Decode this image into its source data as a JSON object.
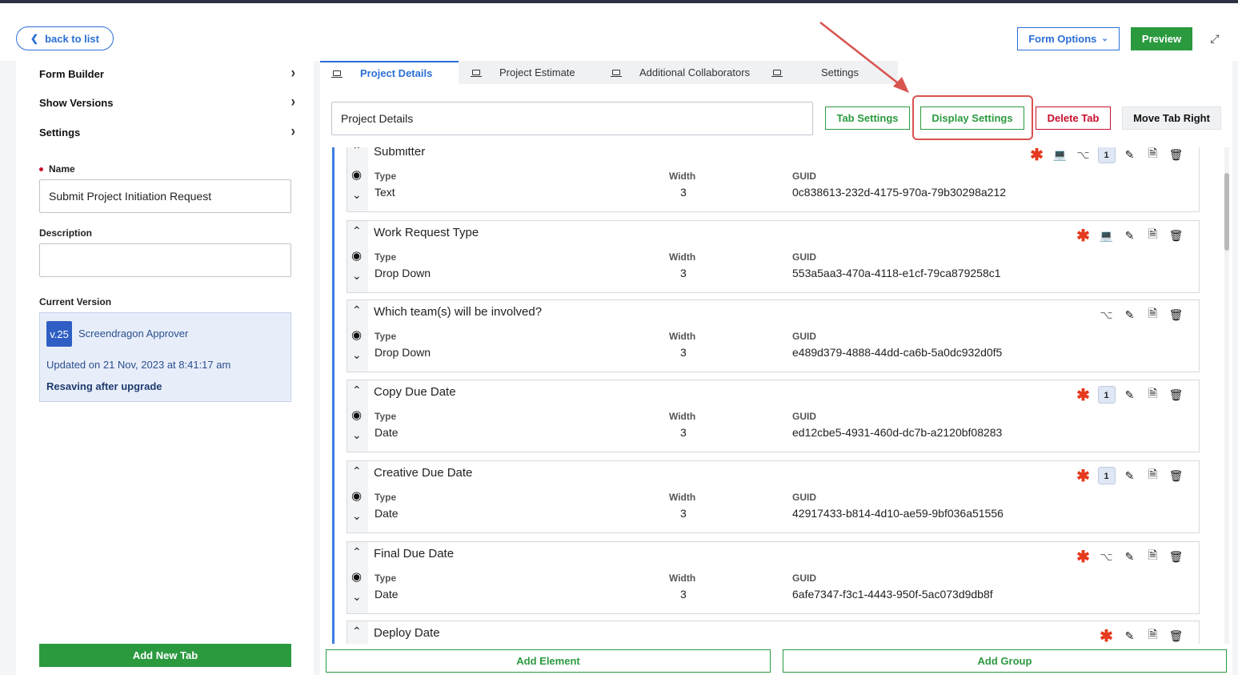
{
  "header": {
    "back_label": "back to list",
    "form_options_label": "Form Options",
    "preview_label": "Preview"
  },
  "sidebar": {
    "menu": [
      {
        "label": "Form Builder"
      },
      {
        "label": "Show Versions"
      },
      {
        "label": "Settings"
      }
    ],
    "name_label": "Name",
    "name_value": "Submit Project Initiation Request",
    "description_label": "Description",
    "description_value": "",
    "current_version_label": "Current Version",
    "version": {
      "badge": "v.25",
      "approver": "Screendragon Approver",
      "updated": "Updated on 21 Nov, 2023 at 8:41:17 am",
      "note": "Resaving after upgrade"
    },
    "add_tab_label": "Add New Tab"
  },
  "tabs": [
    {
      "label": "Project Details",
      "active": true
    },
    {
      "label": "Project Estimate",
      "active": false
    },
    {
      "label": "Additional Collaborators",
      "active": false
    },
    {
      "label": "Settings",
      "active": false
    }
  ],
  "tab_toolbar": {
    "tab_name_value": "Project Details",
    "tab_settings_label": "Tab Settings",
    "display_settings_label": "Display Settings",
    "delete_tab_label": "Delete Tab",
    "move_tab_right_label": "Move Tab Right"
  },
  "element_labels": {
    "type": "Type",
    "width": "Width",
    "guid": "GUID"
  },
  "elements": [
    {
      "title": "Submitter",
      "type": "Text",
      "width": "3",
      "guid": "0c838613-232d-4175-970a-79b30298a212",
      "icons": [
        "required-icon",
        "laptop-icon",
        "share-icon",
        "badge-1",
        "edit-icon",
        "copy-icon",
        "delete-icon"
      ]
    },
    {
      "title": "Work Request Type",
      "type": "Drop Down",
      "width": "3",
      "guid": "553a5aa3-470a-4118-e1cf-79ca879258c1",
      "icons": [
        "required-icon",
        "laptop-icon",
        "edit-icon",
        "copy-icon",
        "delete-icon"
      ]
    },
    {
      "title": "Which team(s) will be involved?",
      "type": "Drop Down",
      "width": "3",
      "guid": "e489d379-4888-44dd-ca6b-5a0dc932d0f5",
      "icons": [
        "share-icon",
        "edit-icon",
        "copy-icon",
        "delete-icon"
      ]
    },
    {
      "title": "Copy Due Date",
      "type": "Date",
      "width": "3",
      "guid": "ed12cbe5-4931-460d-dc7b-a2120bf08283",
      "icons": [
        "required-icon",
        "badge-1",
        "edit-icon",
        "copy-icon",
        "delete-icon"
      ]
    },
    {
      "title": "Creative Due Date",
      "type": "Date",
      "width": "3",
      "guid": "42917433-b814-4d10-ae59-9bf036a51556",
      "icons": [
        "required-icon",
        "badge-1",
        "edit-icon",
        "copy-icon",
        "delete-icon"
      ]
    },
    {
      "title": "Final Due Date",
      "type": "Date",
      "width": "3",
      "guid": "6afe7347-f3c1-4443-950f-5ac073d9db8f",
      "icons": [
        "required-icon",
        "share-icon",
        "edit-icon",
        "copy-icon",
        "delete-icon"
      ]
    },
    {
      "title": "Deploy Date",
      "type": "",
      "width": "",
      "guid": "",
      "icons": [
        "required-icon",
        "edit-icon",
        "copy-icon",
        "delete-icon"
      ]
    }
  ],
  "badge_value": "1",
  "bottom": {
    "add_element_label": "Add Element",
    "add_group_label": "Add Group"
  },
  "colors": {
    "accent": "#2a6fd6",
    "success": "#2b9a3f",
    "danger": "#c8102e",
    "highlight": "#d9534f",
    "required": "#e53a1e"
  }
}
